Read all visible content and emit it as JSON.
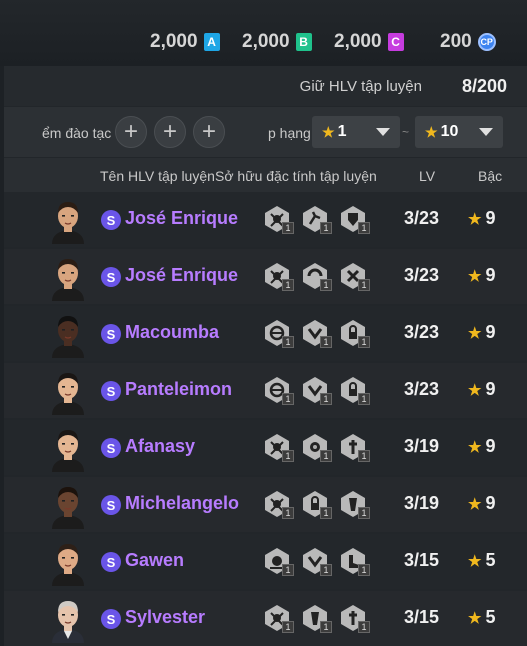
{
  "currencies": [
    {
      "value": "2,000",
      "badge": "A",
      "color": "#1ea6e6"
    },
    {
      "value": "2,000",
      "badge": "B",
      "color": "#1fc28c"
    },
    {
      "value": "2,000",
      "badge": "C",
      "color": "#c63cdf"
    },
    {
      "value": "200",
      "badge": "CP",
      "color": "#3e84f0"
    }
  ],
  "hold": {
    "label": "Giữ HLV tập luyện",
    "count": "8/200"
  },
  "filters": {
    "training_label": "ểm đào tạc",
    "rank_label": "p hạng",
    "min_rank": "1",
    "max_rank": "10",
    "separator": "~"
  },
  "columns": {
    "name": "Tên HLV tập luyện",
    "traits": "Sở hữu đặc tính tập luyện",
    "lv": "LV",
    "rank": "Bậc"
  },
  "coaches": [
    {
      "grade": "S",
      "name": "José Enrique",
      "lv": "3/23",
      "rank": "9",
      "skin": "#d8a57f",
      "hair": "#2b1d14",
      "traits": [
        "1",
        "1",
        "1"
      ],
      "trait_icons": [
        "whistle-icon",
        "run-icon",
        "shield-icon"
      ]
    },
    {
      "grade": "S",
      "name": "José Enrique",
      "lv": "3/23",
      "rank": "9",
      "skin": "#d8a57f",
      "hair": "#2b1d14",
      "traits": [
        "1",
        "1",
        "1"
      ],
      "trait_icons": [
        "whistle-icon",
        "stamina-icon",
        "strategy-icon"
      ]
    },
    {
      "grade": "S",
      "name": "Macoumba",
      "lv": "3/23",
      "rank": "9",
      "skin": "#4a2e22",
      "hair": "#111111",
      "traits": [
        "1",
        "1",
        "1"
      ],
      "trait_icons": [
        "ball-icon",
        "cross-icon",
        "lock-icon"
      ]
    },
    {
      "grade": "S",
      "name": "Panteleimon",
      "lv": "3/23",
      "rank": "9",
      "skin": "#e4b692",
      "hair": "#1a1614",
      "traits": [
        "1",
        "1",
        "1"
      ],
      "trait_icons": [
        "ball-icon",
        "cross-icon",
        "lock-icon"
      ]
    },
    {
      "grade": "S",
      "name": "Afanasy",
      "lv": "3/19",
      "rank": "9",
      "skin": "#e4b692",
      "hair": "#1a1614",
      "traits": [
        "1",
        "1",
        "1"
      ],
      "trait_icons": [
        "whistle-icon",
        "focus-icon",
        "target-icon"
      ]
    },
    {
      "grade": "S",
      "name": "Michelangelo",
      "lv": "3/19",
      "rank": "9",
      "skin": "#6a4430",
      "hair": "#1c120c",
      "traits": [
        "1",
        "1",
        "1"
      ],
      "trait_icons": [
        "whistle-icon",
        "lock-icon",
        "tactic-icon"
      ]
    },
    {
      "grade": "S",
      "name": "Gawen",
      "lv": "3/15",
      "rank": "5",
      "skin": "#deaa86",
      "hair": "#2d2018",
      "traits": [
        "1",
        "1",
        "1"
      ],
      "trait_icons": [
        "dribble-icon",
        "cross-icon",
        "boot-icon"
      ]
    },
    {
      "grade": "S",
      "name": "Sylvester",
      "lv": "3/15",
      "rank": "5",
      "skin": "#e6c4ac",
      "hair": "#cfcac4",
      "traits": [
        "1",
        "1",
        "1"
      ],
      "trait_icons": [
        "whistle-icon",
        "tactic-icon",
        "target-icon"
      ]
    }
  ]
}
